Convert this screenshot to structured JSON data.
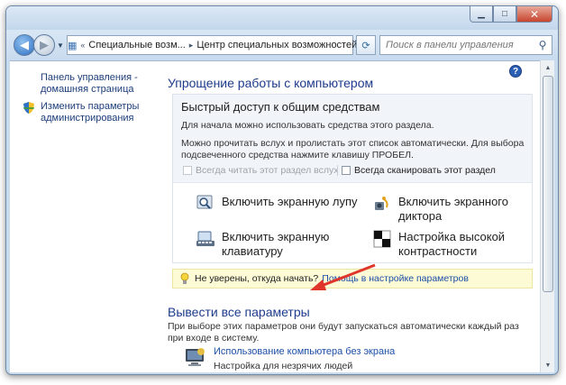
{
  "window": {
    "address": {
      "segments": [
        "Специальные возм...",
        "Центр специальных возможностей"
      ]
    },
    "search": {
      "placeholder": "Поиск в панели управления"
    }
  },
  "left_pane": {
    "links": [
      "Панель управления - домашняя страница",
      "Изменить параметры администрирования"
    ]
  },
  "main": {
    "heading": "Упрощение работы с компьютером",
    "quick_access": {
      "title": "Быстрый доступ к общим средствам",
      "intro": "Для начала можно использовать средства этого раздела.",
      "instructions": "Можно прочитать вслух и пролистать этот список автоматически. Для выбора подсвеченного средства нажмите клавишу ПРОБЕЛ.",
      "check_read": "Всегда читать этот раздел вслух",
      "check_scan": "Всегда сканировать этот раздел"
    },
    "tools": {
      "magnifier": "Включить экранную лупу",
      "narrator": "Включить экранного диктора",
      "osk": "Включить экранную клавиатуру",
      "contrast": "Настройка высокой контрастности"
    },
    "hint": {
      "question": "Не уверены, откуда начать?",
      "link": "Помощь в настройке параметров"
    },
    "all_settings": {
      "heading": "Вывести все параметры",
      "description": "При выборе этих параметров они будут запускаться автоматически каждый раз при входе в систему.",
      "item_link": "Использование компьютера без экрана",
      "item_sub": "Настройка для незрячих людей"
    }
  },
  "colors": {
    "heading_blue": "#1e3b8c",
    "link_blue": "#1d4ea6",
    "hint_bg": "#fdfbd6",
    "annotation_arrow": "#e0352b"
  }
}
